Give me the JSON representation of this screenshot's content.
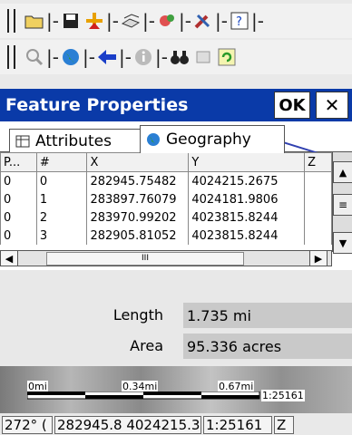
{
  "toolbar1": {
    "icons": [
      "open-icon",
      "save-icon",
      "add-icon",
      "layers-icon",
      "gps-icon",
      "tools-icon",
      "help-icon"
    ]
  },
  "toolbar2": {
    "icons": [
      "zoom-icon",
      "globe-icon",
      "back-icon",
      "info-icon",
      "binoculars-icon",
      "map-icon",
      "refresh-icon"
    ]
  },
  "dialog": {
    "title": "Feature Properties",
    "ok_label": "OK",
    "close_label": "✕",
    "tabs": [
      "Attributes",
      "Geography"
    ],
    "columns": [
      "P...",
      "#",
      "X",
      "Y",
      "Z"
    ],
    "rows": [
      {
        "p": "0",
        "n": "0",
        "x": "282945.75482",
        "y": "4024215.2675",
        "z": ""
      },
      {
        "p": "0",
        "n": "1",
        "x": "283897.76079",
        "y": "4024181.9806",
        "z": ""
      },
      {
        "p": "0",
        "n": "2",
        "x": "283970.99202",
        "y": "4023815.8244",
        "z": ""
      },
      {
        "p": "0",
        "n": "3",
        "x": "282905.81052",
        "y": "4023815.8244",
        "z": ""
      }
    ],
    "scroll_thumb_glyph": "III",
    "fields": [
      {
        "label": "Length",
        "value": "1.735 mi"
      },
      {
        "label": "Area",
        "value": "95.336 acres"
      }
    ]
  },
  "scale": {
    "labels": [
      "0mi",
      "0.34mi",
      "0.67mi"
    ],
    "ratio": "1:25161"
  },
  "status": {
    "heading": "272° (",
    "coords": "282945.8 4024215.3 (",
    "ratio": "1:25161",
    "extra": "Z"
  },
  "colors": {
    "titlebar": "#0a3aa8",
    "title_text": "#ffffff"
  }
}
